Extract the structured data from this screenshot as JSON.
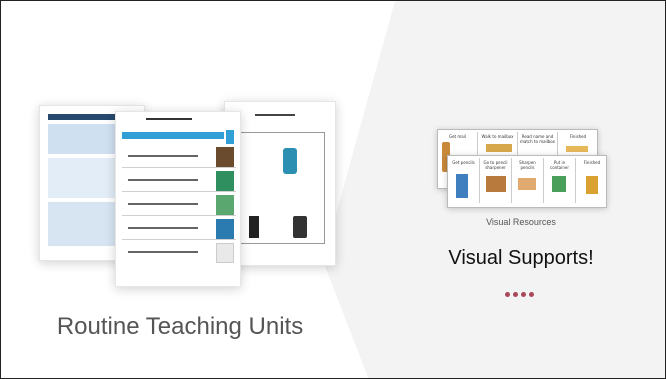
{
  "left_panel": {
    "caption": "Routine Teaching Units",
    "image_description": "routine-teaching-unit-documents"
  },
  "right_panel": {
    "image_caption": "Visual Resources",
    "title": "Visual Supports!",
    "dot_count": 4,
    "strip_top_labels": [
      "Get mail",
      "Walk to mailbox",
      "Read name and match to mailbox",
      "Finished"
    ],
    "strip_bottom_labels": [
      "Get pencils",
      "Go to pencil sharpener",
      "Sharpen pencils",
      "Put in container",
      "Finished"
    ]
  },
  "colors": {
    "accent_dots": "#a8485a",
    "diagonal_bg": "#f2f2f2",
    "doc_header_blue": "#3f7fbf",
    "front_title_blue": "#2f9fd6"
  }
}
